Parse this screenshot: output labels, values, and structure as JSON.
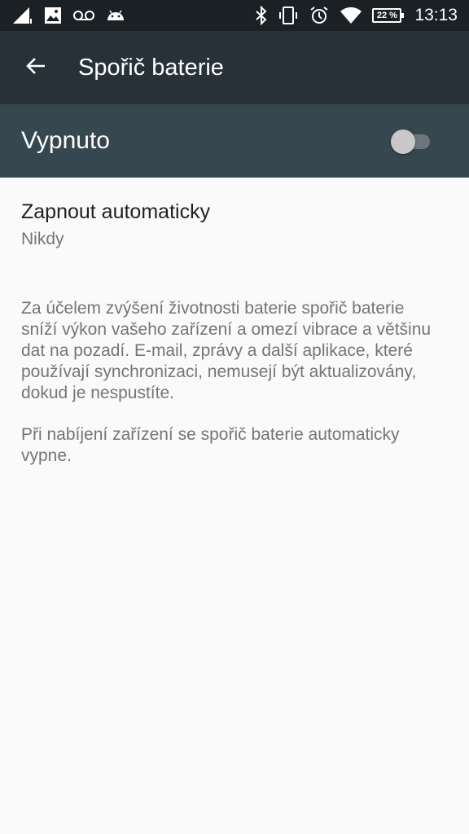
{
  "status_bar": {
    "battery_percent": "22 %",
    "time": "13:13",
    "icons": [
      "signal-icon",
      "image-notification-icon",
      "voicemail-icon",
      "android-icon",
      "bluetooth-icon",
      "vibrate-icon",
      "alarm-icon",
      "wifi-icon",
      "battery-icon"
    ],
    "text_color": "#ffffff",
    "background": "#1a2024"
  },
  "app_bar": {
    "title": "Spořič baterie",
    "background": "#263238"
  },
  "master_switch": {
    "label": "Vypnuto",
    "checked": false,
    "background": "#37474f"
  },
  "auto_setting": {
    "title": "Zapnout automaticky",
    "summary": "Nikdy"
  },
  "footer": {
    "description": "Za účelem zvýšení životnosti baterie spořič baterie sníží výkon vašeho zařízení a omezí vibrace a většinu dat na pozadí. E-mail, zprávy a další aplikace, které používají synchronizaci, nemusejí být aktualizovány, dokud je nespustíte.",
    "charging_note": "Při nabíjení zařízení se spořič baterie automaticky vypne."
  }
}
